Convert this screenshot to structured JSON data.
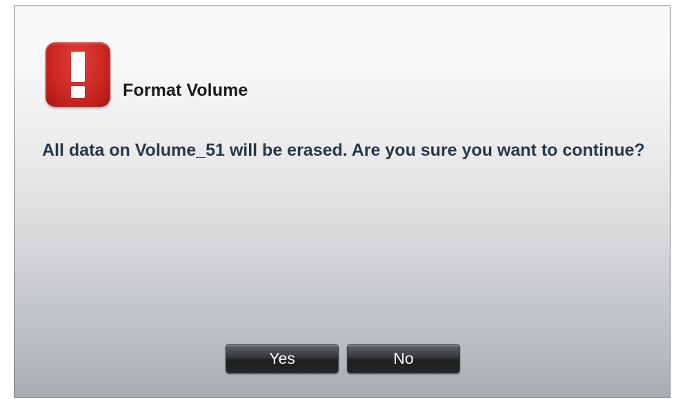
{
  "dialog": {
    "title": "Format Volume",
    "icon": "exclamation-warning-icon",
    "message": "All data on Volume_51 will be erased. Are you sure you want to continue?"
  },
  "buttons": {
    "yes_label": "Yes",
    "no_label": "No"
  },
  "colors": {
    "icon_red": "#cc2824",
    "message_text": "#263849",
    "button_dark": "#2a2b2e"
  }
}
